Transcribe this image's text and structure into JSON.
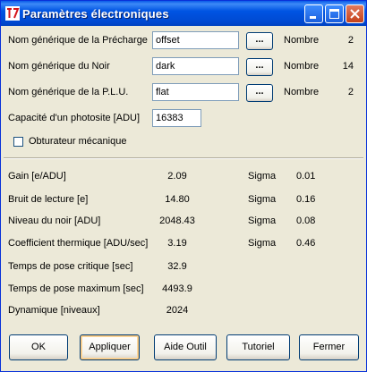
{
  "window": {
    "title": "Paramètres électroniques"
  },
  "generic_names": [
    {
      "label": "Nom générique de la Précharge",
      "value": "offset",
      "browse_label": "...",
      "count_label": "Nombre",
      "count": "2"
    },
    {
      "label": "Nom générique du Noir",
      "value": "dark",
      "browse_label": "...",
      "count_label": "Nombre",
      "count": "14"
    },
    {
      "label": "Nom générique de la P.L.U.",
      "value": "flat",
      "browse_label": "...",
      "count_label": "Nombre",
      "count": "2"
    }
  ],
  "photosite": {
    "label": "Capacité d'un photosite [ADU]",
    "value": "16383"
  },
  "shutter": {
    "label": "Obturateur mécanique",
    "checked": false
  },
  "results": [
    {
      "label": "Gain [e/ADU]",
      "value": "2.09",
      "sigma_label": "Sigma",
      "sigma": "0.01"
    },
    {
      "label": "Bruit de lecture [e]",
      "value": "14.80",
      "sigma_label": "Sigma",
      "sigma": "0.16"
    },
    {
      "label": "Niveau du noir [ADU]",
      "value": "2048.43",
      "sigma_label": "Sigma",
      "sigma": "0.08"
    },
    {
      "label": "Coefficient thermique [ADU/sec]",
      "value": "3.19",
      "sigma_label": "Sigma",
      "sigma": "0.46"
    },
    {
      "label": "Temps de pose critique [sec]",
      "value": "32.9"
    },
    {
      "label": "Temps de pose maximum [sec]",
      "value": "4493.9"
    },
    {
      "label": "Dynamique [niveaux]",
      "value": "2024"
    }
  ],
  "buttons": {
    "ok": "OK",
    "apply": "Appliquer",
    "help": "Aide Outil",
    "tutorial": "Tutoriel",
    "close": "Fermer"
  }
}
